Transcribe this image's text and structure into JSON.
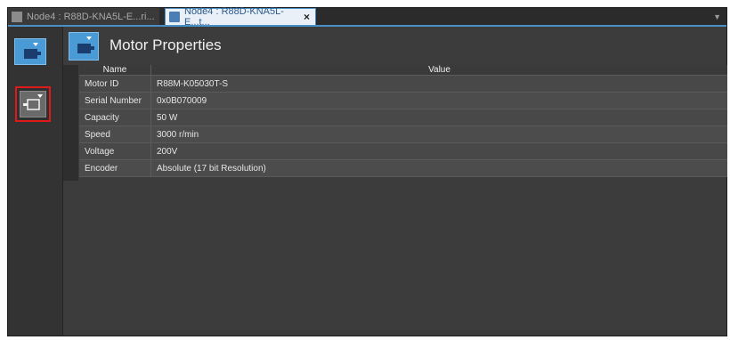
{
  "tabs": [
    {
      "label": "Node4 : R88D-KNA5L-E...ri...",
      "active": false
    },
    {
      "label": "Node4 : R88D-KNA5L-E...t...",
      "active": true,
      "close": "×"
    }
  ],
  "scroll_arrow": "▼",
  "sidebar": {
    "items": [
      {
        "name": "motor-properties",
        "icon": "motor-icon",
        "selected": true
      },
      {
        "name": "servo-drive",
        "icon": "drive-icon",
        "selected": false,
        "highlighted": true
      }
    ]
  },
  "page_title": "Motor Properties",
  "table": {
    "columns": [
      "Name",
      "Value"
    ],
    "rows": [
      {
        "name": "Motor ID",
        "value": "R88M-K05030T-S"
      },
      {
        "name": "Serial Number",
        "value": "0x0B070009"
      },
      {
        "name": "Capacity",
        "value": "50 W"
      },
      {
        "name": "Speed",
        "value": "3000 r/min"
      },
      {
        "name": "Voltage",
        "value": "200V"
      },
      {
        "name": "Encoder",
        "value": "Absolute (17 bit Resolution)"
      }
    ]
  },
  "colors": {
    "accent": "#4a9ad6",
    "highlight_border": "#e01a1a",
    "background": "#3c3c3c"
  }
}
